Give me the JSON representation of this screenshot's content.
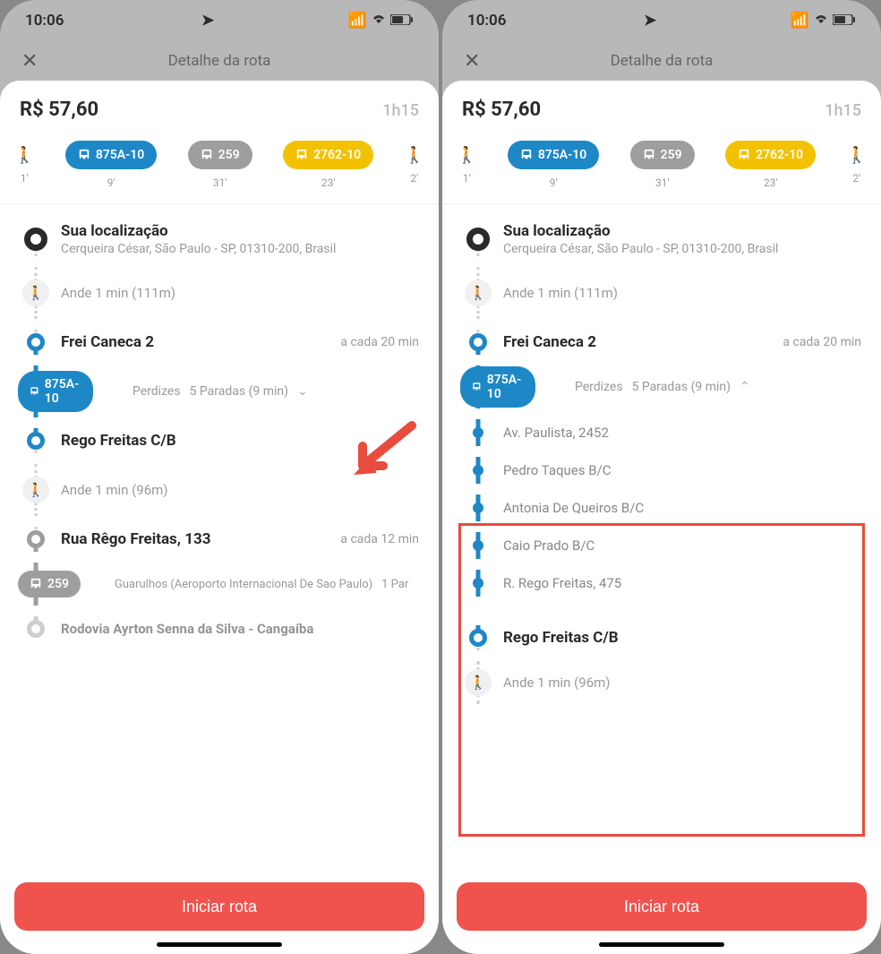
{
  "status": {
    "time": "10:06"
  },
  "header": {
    "title": "Detalhe da rota",
    "close": "✕"
  },
  "summary": {
    "price": "R$ 57,60",
    "duration": "1h15"
  },
  "legs": [
    {
      "type": "walk",
      "time": "1'"
    },
    {
      "type": "bus",
      "color": "blue",
      "label": "875A-10",
      "time": "9'"
    },
    {
      "type": "bus",
      "color": "gray",
      "label": "259",
      "time": "31'"
    },
    {
      "type": "bus",
      "color": "yellow",
      "label": "2762-10",
      "time": "23'"
    },
    {
      "type": "walk",
      "time": "2'"
    }
  ],
  "left": {
    "origin": {
      "title": "Sua localização",
      "sub": "Cerqueira César, São Paulo - SP, 01310-200, Brasil"
    },
    "walk1": "Ande 1 min (111m)",
    "stop1": {
      "title": "Frei Caneca 2",
      "freq": "a cada 20 min"
    },
    "line1": {
      "label": "875A-10",
      "dest": "Perdizes",
      "stops": "5 Paradas (9 min)"
    },
    "stop2": {
      "title": "Rego Freitas C/B"
    },
    "walk2": "Ande 1 min (96m)",
    "stop3": {
      "title": "Rua Rêgo Freitas, 133",
      "freq": "a cada 12 min"
    },
    "line2": {
      "label": "259",
      "dest": "Guarulhos (Aeroporto Internacional De Sao Paulo)",
      "stops": "1 Par"
    },
    "stop4": {
      "title": "Rodovia Ayrton Senna da Silva - Cangaíba"
    }
  },
  "right": {
    "origin": {
      "title": "Sua localização",
      "sub": "Cerqueira César, São Paulo - SP, 01310-200, Brasil"
    },
    "walk1": "Ande 1 min (111m)",
    "stop1": {
      "title": "Frei Caneca 2",
      "freq": "a cada 20 min"
    },
    "line1": {
      "label": "875A-10",
      "dest": "Perdizes",
      "stops": "5 Paradas (9 min)"
    },
    "substops": [
      "Av. Paulista, 2452",
      "Pedro Taques B/C",
      "Antonia De Queiros B/C",
      "Caio Prado B/C",
      "R. Rego Freitas, 475"
    ],
    "stop2": {
      "title": "Rego Freitas C/B"
    },
    "walk2": "Ande 1 min (96m)"
  },
  "cta": "Iniciar rota"
}
